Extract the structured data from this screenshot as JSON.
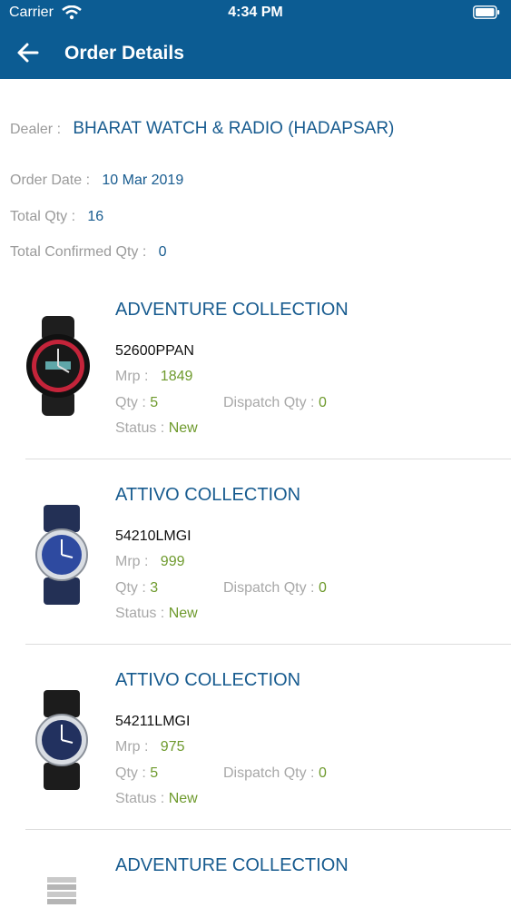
{
  "status_bar": {
    "carrier": "Carrier",
    "time": "4:34 PM"
  },
  "header": {
    "title": "Order Details"
  },
  "order": {
    "dealer_label": "Dealer :",
    "dealer_value": "BHARAT WATCH & RADIO (HADAPSAR)",
    "order_date_label": "Order Date :",
    "order_date_value": "10 Mar 2019",
    "total_qty_label": "Total Qty :",
    "total_qty_value": "16",
    "confirmed_label": "Total Confirmed Qty :",
    "confirmed_value": "0"
  },
  "labels": {
    "mrp": "Mrp :",
    "qty": "Qty :",
    "dispatch": "Dispatch Qty :",
    "status": "Status :"
  },
  "products": [
    {
      "collection": "ADVENTURE COLLECTION",
      "code": "52600PPAN",
      "mrp": "1849",
      "qty": "5",
      "dispatch_qty": "0",
      "status": "New"
    },
    {
      "collection": "ATTIVO COLLECTION",
      "code": "54210LMGI",
      "mrp": "999",
      "qty": "3",
      "dispatch_qty": "0",
      "status": "New"
    },
    {
      "collection": "ATTIVO COLLECTION",
      "code": "54211LMGI",
      "mrp": "975",
      "qty": "5",
      "dispatch_qty": "0",
      "status": "New"
    },
    {
      "collection": "ADVENTURE COLLECTION"
    }
  ]
}
